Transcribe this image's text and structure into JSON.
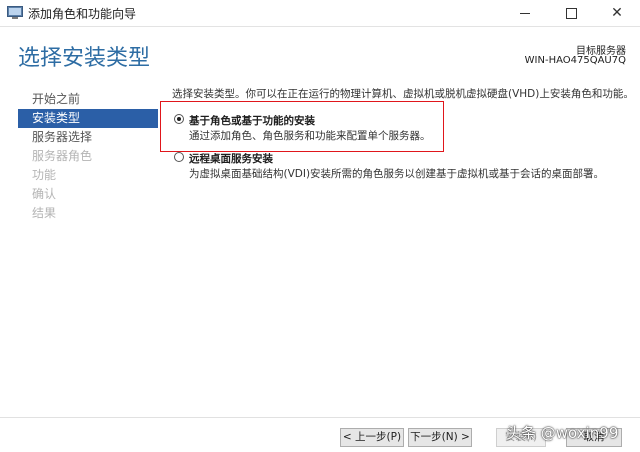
{
  "window": {
    "title": "添加角色和功能向导",
    "min_icon": "minimize-icon",
    "max_icon": "maximize-icon",
    "close_icon": "close-icon"
  },
  "header": {
    "page_title": "选择安装类型",
    "target_label": "目标服务器",
    "target_name": "WIN-HAO475QAU7Q"
  },
  "nav": {
    "items": [
      {
        "label": "开始之前",
        "state": "normal"
      },
      {
        "label": "安装类型",
        "state": "active"
      },
      {
        "label": "服务器选择",
        "state": "normal"
      },
      {
        "label": "服务器角色",
        "state": "disabled"
      },
      {
        "label": "功能",
        "state": "disabled"
      },
      {
        "label": "确认",
        "state": "disabled"
      },
      {
        "label": "结果",
        "state": "disabled"
      }
    ]
  },
  "content": {
    "intro": "选择安装类型。你可以在正在运行的物理计算机、虚拟机或脱机虚拟硬盘(VHD)上安装角色和功能。",
    "options": [
      {
        "label": "基于角色或基于功能的安装",
        "desc": "通过添加角色、角色服务和功能来配置单个服务器。",
        "selected": true
      },
      {
        "label": "远程桌面服务安装",
        "desc": "为虚拟桌面基础结构(VDI)安装所需的角色服务以创建基于虚拟机或基于会话的桌面部署。",
        "selected": false
      }
    ]
  },
  "footer": {
    "prev": "< 上一步(P)",
    "next": "下一步(N) >",
    "install": "安装(I)",
    "cancel": "取消"
  },
  "watermark": "头条 @woxin99",
  "colors": {
    "accent": "#2b5fa7",
    "title": "#2e6da4",
    "highlight": "#e0161b"
  }
}
